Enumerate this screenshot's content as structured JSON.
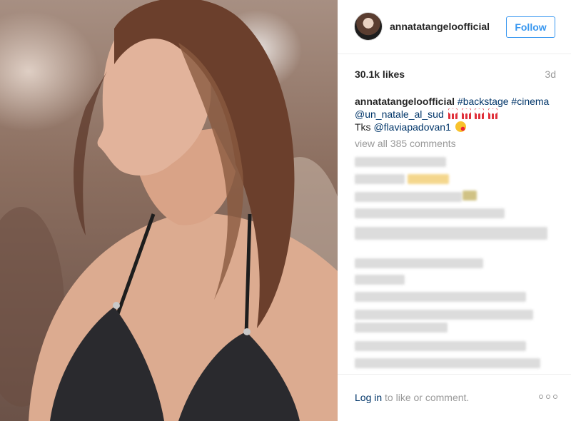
{
  "post": {
    "username": "annatatangeloofficial",
    "follow_label": "Follow",
    "likes": "30.1k likes",
    "age": "3d",
    "caption": {
      "user": "annatatangeloofficial",
      "tag_backstage": "#backstage",
      "tag_cinema": "#cinema",
      "mention_natale": "@un_natale_al_sud",
      "tks": "Tks",
      "mention_flavia": "@flaviapadovan1"
    },
    "view_all": "view all 385 comments",
    "login_link": "Log in",
    "login_suffix": " to like or comment."
  },
  "icons": {
    "caption_emoji": "popcorn-icon",
    "kiss_emoji": "kiss-face-icon",
    "more": "more-options-icon"
  },
  "colors": {
    "follow_blue": "#3897f0",
    "link": "#003569",
    "muted": "#999999"
  }
}
